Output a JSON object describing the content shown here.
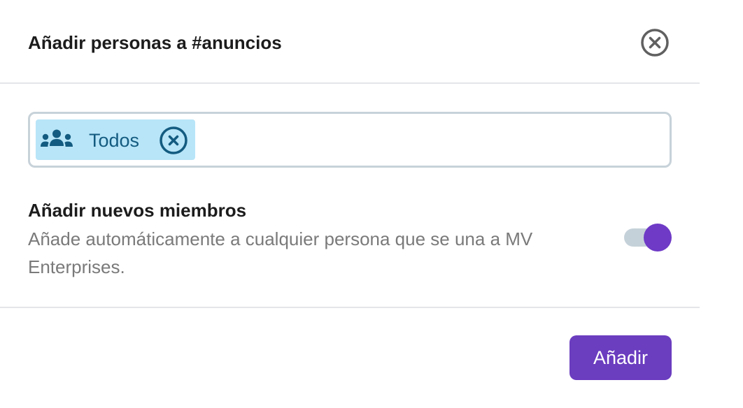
{
  "dialog": {
    "title": "Añadir personas a #anuncios",
    "close_icon": "close-circle-icon"
  },
  "people_input": {
    "chips": [
      {
        "icon": "group-icon",
        "label": "Todos",
        "remove_icon": "remove-circle-icon"
      }
    ]
  },
  "setting": {
    "title": "Añadir nuevos miembros",
    "description": "Añade automáticamente a cualquier persona que se una a MV Enterprises.",
    "toggle_on": true
  },
  "footer": {
    "submit_label": "Añadir"
  },
  "colors": {
    "accent": "#6b3dbf",
    "chip_background": "#b8e5f8",
    "chip_text": "#135b80",
    "muted_text": "#7a7a7a",
    "divider": "#e3e5e8"
  }
}
